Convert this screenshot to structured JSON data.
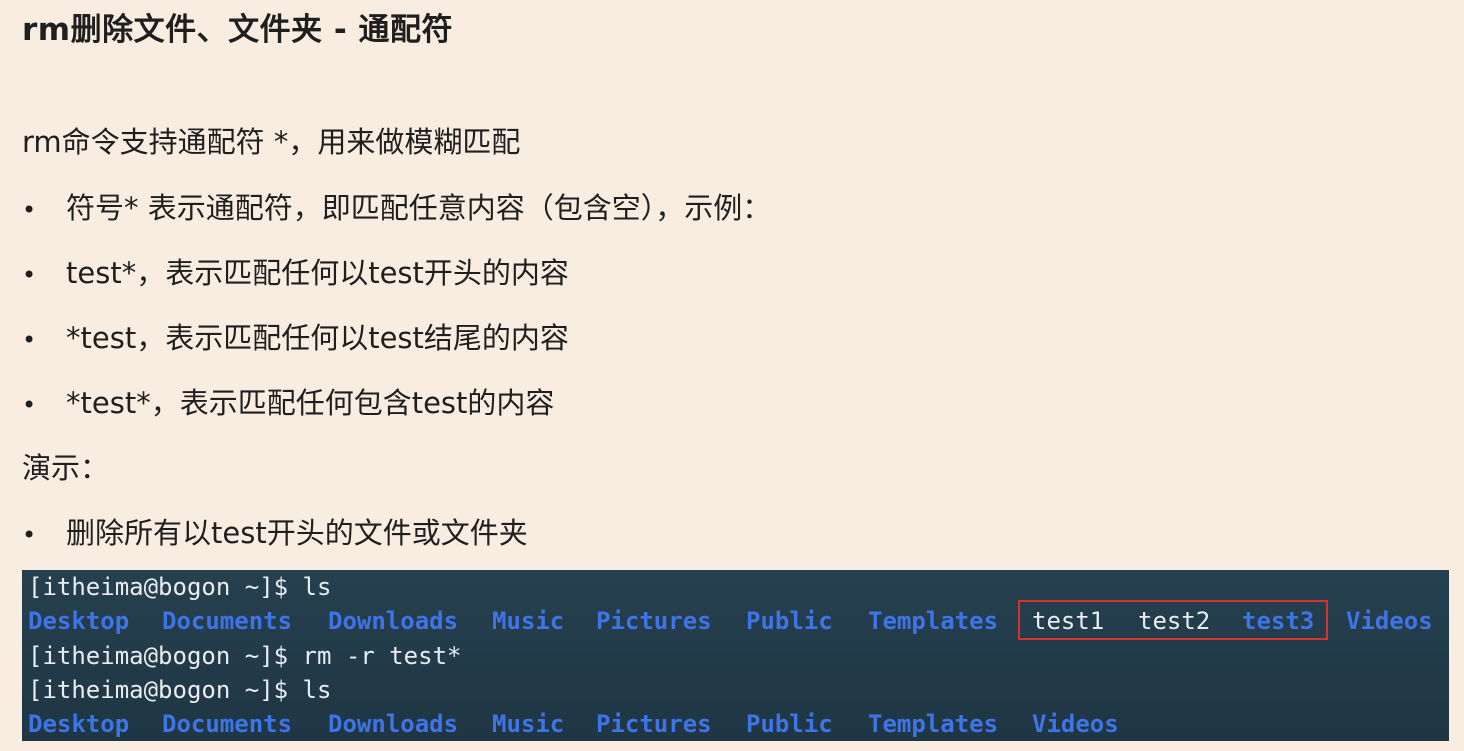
{
  "title": "rm删除文件、文件夹 - 通配符",
  "intro": "rm命令支持通配符 *，用来做模糊匹配",
  "bullets": [
    "符号* 表示通配符，即匹配任意内容（包含空），示例：",
    "test*，表示匹配任何以test开头的内容",
    "*test，表示匹配任何以test结尾的内容",
    "*test*，表示匹配任何包含test的内容"
  ],
  "demo_label": "演示：",
  "demo_bullet": "删除所有以test开头的文件或文件夹",
  "bullet_char": "•",
  "terminal": {
    "prompt1": "[itheima@bogon ~]$ ls",
    "ls1": [
      {
        "name": "Desktop",
        "kind": "dir"
      },
      {
        "name": "Documents",
        "kind": "dir"
      },
      {
        "name": "Downloads",
        "kind": "dir"
      },
      {
        "name": "Music",
        "kind": "dir"
      },
      {
        "name": "Pictures",
        "kind": "dir"
      },
      {
        "name": "Public",
        "kind": "dir"
      },
      {
        "name": "Templates",
        "kind": "dir"
      },
      {
        "name": "test1",
        "kind": "file"
      },
      {
        "name": "test2",
        "kind": "file"
      },
      {
        "name": "test3",
        "kind": "dir"
      },
      {
        "name": "Videos",
        "kind": "dir"
      }
    ],
    "prompt2": "[itheima@bogon ~]$ rm -r test*",
    "prompt3": "[itheima@bogon ~]$ ls",
    "ls2": [
      {
        "name": "Desktop",
        "kind": "dir"
      },
      {
        "name": "Documents",
        "kind": "dir"
      },
      {
        "name": "Downloads",
        "kind": "dir"
      },
      {
        "name": "Music",
        "kind": "dir"
      },
      {
        "name": "Pictures",
        "kind": "dir"
      },
      {
        "name": "Public",
        "kind": "dir"
      },
      {
        "name": "Templates",
        "kind": "dir"
      },
      {
        "name": "Videos",
        "kind": "dir"
      }
    ],
    "dir_color": "#3f74e6",
    "file_color": "#e8ecef",
    "highlight_color": "#d9322c"
  }
}
